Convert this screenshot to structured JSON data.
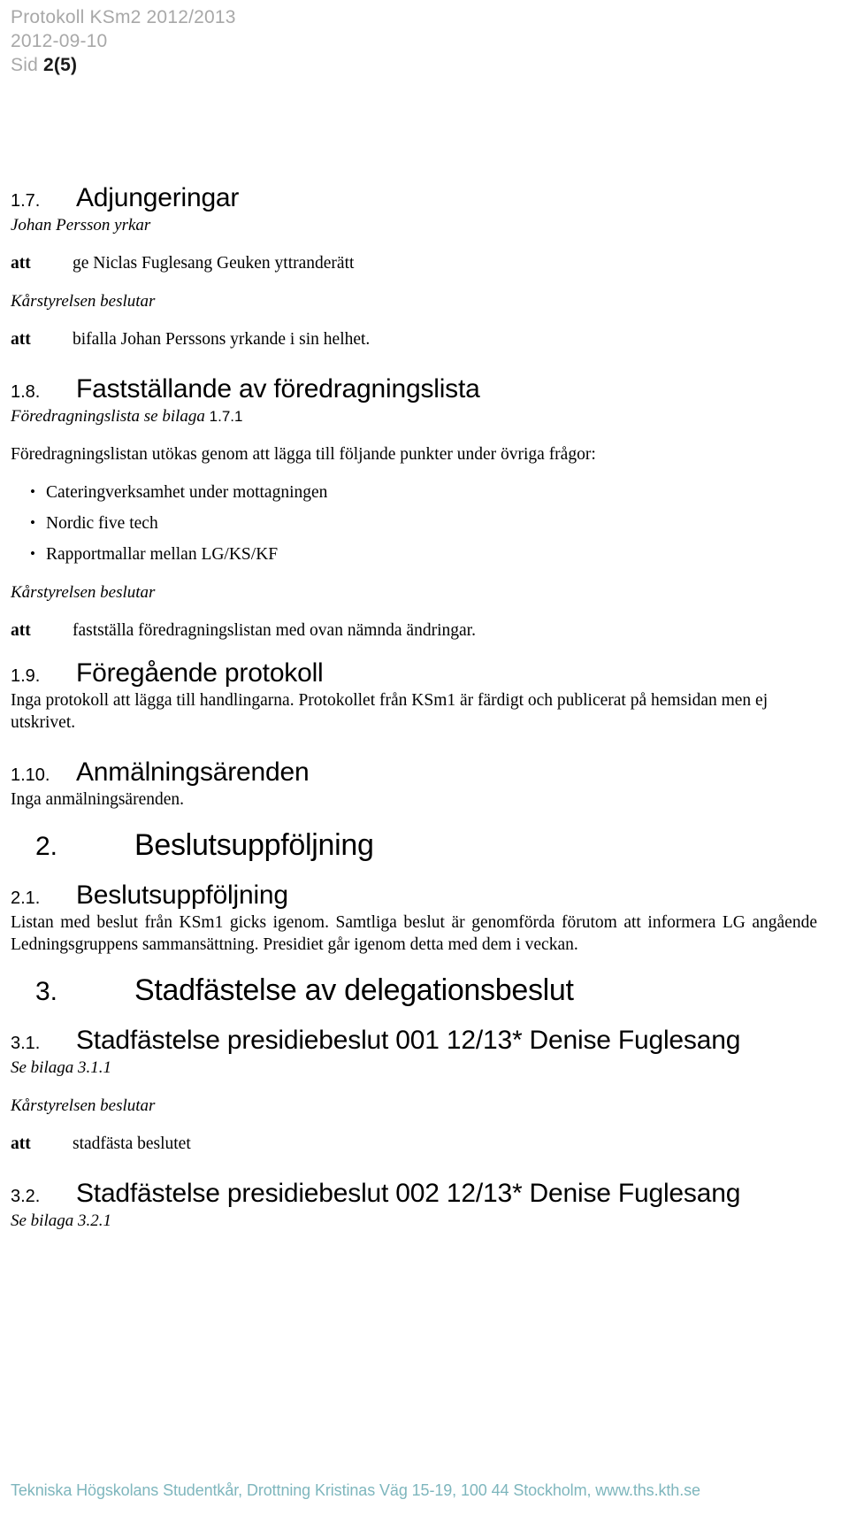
{
  "header": {
    "title_line": "Protokoll KSm2 2012/2013",
    "date_line": "2012-09-10",
    "page_label": "Sid ",
    "page_number": "2(5)"
  },
  "sections": {
    "s17": {
      "number": "1.7.",
      "title": "Adjungeringar",
      "intro_italic": "Johan Persson yrkar",
      "att1_label": "att",
      "att1_text": "ge Niclas Fuglesang Geuken yttranderätt",
      "decision_italic": "Kårstyrelsen beslutar",
      "att2_label": "att",
      "att2_text": "bifalla Johan Perssons yrkande i sin helhet."
    },
    "s18": {
      "number": "1.8.",
      "title": "Fastställande av föredragningslista",
      "attachment_italic": "Föredragningslista se bilaga ",
      "attachment_num": "1.7.1",
      "intro": "Föredragningslistan utökas genom att lägga till följande punkter under övriga frågor:",
      "bullets": [
        "Cateringverksamhet under mottagningen",
        "Nordic five tech",
        "Rapportmallar mellan LG/KS/KF"
      ],
      "decision_italic": "Kårstyrelsen beslutar",
      "att_label": "att",
      "att_text": "fastställa föredragningslistan med ovan nämnda ändringar."
    },
    "s19": {
      "number": "1.9.",
      "title": "Föregående protokoll",
      "body": "Inga protokoll att lägga till handlingarna. Protokollet från KSm1 är färdigt och publicerat på hemsidan men ej utskrivet."
    },
    "s110": {
      "number": "1.10.",
      "title": "Anmälningsärenden",
      "body": "Inga anmälningsärenden."
    },
    "s2": {
      "number": "2.",
      "title": "Beslutsuppföljning"
    },
    "s21": {
      "number": "2.1.",
      "title": "Beslutsuppföljning",
      "body": "Listan med beslut från KSm1 gicks igenom. Samtliga beslut är genomförda förutom att informera LG angående Ledningsgruppens sammansättning. Presidiet går igenom detta med dem i veckan."
    },
    "s3": {
      "number": "3.",
      "title": "Stadfästelse av delegationsbeslut"
    },
    "s31": {
      "number": "3.1.",
      "title": "Stadfästelse presidiebeslut 001 12/13*  Denise Fuglesang",
      "attachment_italic": "Se bilaga 3.1.1",
      "decision_italic": "Kårstyrelsen beslutar",
      "att_label": "att",
      "att_text": "stadfästa beslutet"
    },
    "s32": {
      "number": "3.2.",
      "title": "Stadfästelse presidiebeslut 002 12/13*  Denise Fuglesang",
      "attachment_italic": "Se bilaga 3.2.1"
    }
  },
  "footer": {
    "text": "Tekniska Högskolans Studentkår, Drottning Kristinas Väg 15-19, 100 44 Stockholm, www.ths.kth.se"
  },
  "colors": {
    "header_gray": "#a8a8a8",
    "footer_teal": "#7eb6bd",
    "text_black": "#000000"
  }
}
